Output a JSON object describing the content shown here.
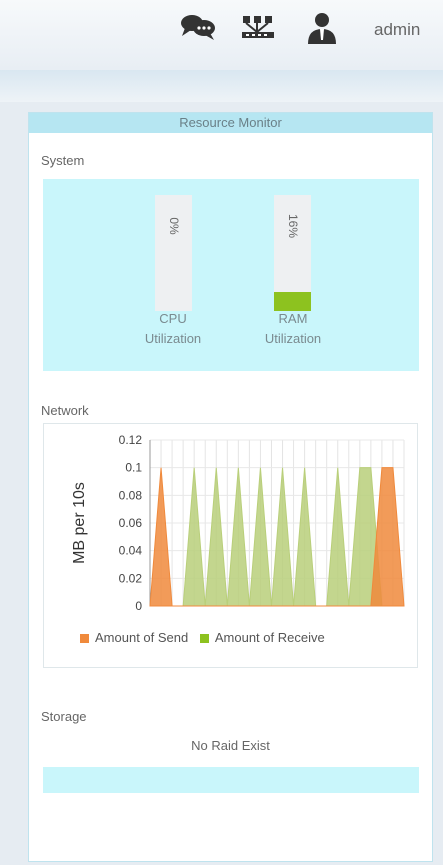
{
  "header": {
    "user": "admin",
    "icons": [
      "chat-icon",
      "network-map-icon",
      "user-icon"
    ]
  },
  "panel": {
    "title": "Resource Monitor",
    "system": {
      "label": "System",
      "gauges": [
        {
          "name": "CPU",
          "label_line1": "CPU",
          "label_line2": "Utilization",
          "percent_text": "0%",
          "percent": 0
        },
        {
          "name": "RAM",
          "label_line1": "RAM",
          "label_line2": "Utilization",
          "percent_text": "16%",
          "percent": 16
        }
      ]
    },
    "network": {
      "label": "Network"
    },
    "storage": {
      "label": "Storage",
      "message": "No Raid Exist"
    }
  },
  "colors": {
    "accent": "#b6e6f2",
    "box": "#c9f6fb",
    "ram_fill": "#8dc21f",
    "send": "#f08a3c",
    "receive": "#b9cf7a"
  },
  "chart_data": {
    "type": "area",
    "ylabel": "MB per 10s",
    "ylim": [
      0,
      0.12
    ],
    "yticks": [
      "0.12",
      "0.1",
      "0.08",
      "0.06",
      "0.04",
      "0.02",
      "0"
    ],
    "x_points": 24,
    "series": [
      {
        "name": "Amount of Send",
        "color": "#f08a3c",
        "values": [
          0,
          0.1,
          0,
          0,
          0,
          0,
          0,
          0,
          0,
          0,
          0,
          0,
          0,
          0,
          0,
          0,
          0,
          0,
          0,
          0,
          0,
          0.1,
          0.1,
          0
        ]
      },
      {
        "name": "Amount of Receive",
        "color": "#b9cf7a",
        "values": [
          0,
          0,
          0,
          0,
          0.1,
          0,
          0.1,
          0,
          0.1,
          0,
          0.1,
          0,
          0.1,
          0,
          0.1,
          0,
          0,
          0.1,
          0,
          0.1,
          0.1,
          0,
          0,
          0
        ]
      }
    ]
  }
}
